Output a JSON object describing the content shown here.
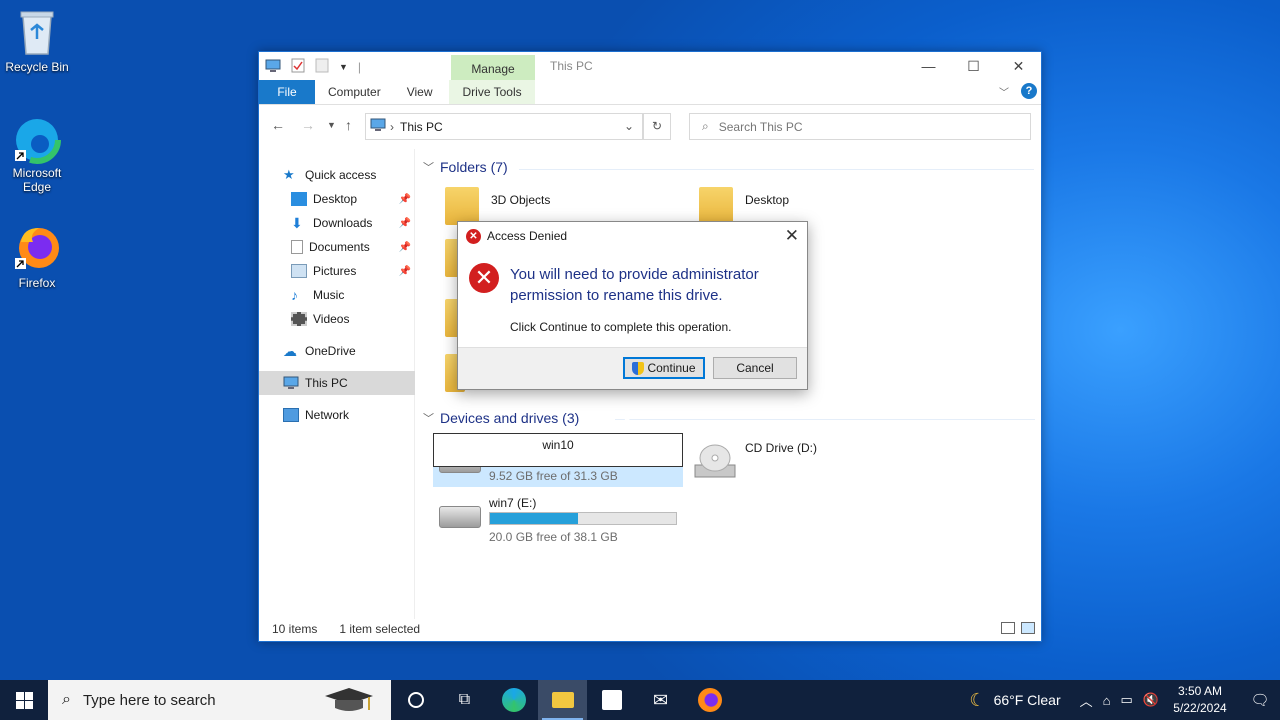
{
  "desktop": {
    "icons": [
      {
        "label": "Recycle Bin"
      },
      {
        "label": "Microsoft Edge"
      },
      {
        "label": "Firefox"
      }
    ]
  },
  "explorer": {
    "title": "This PC",
    "contextual_tab": "Manage",
    "ribbon_tabs": [
      "File",
      "Computer",
      "View",
      "Drive Tools"
    ],
    "address": "This PC",
    "search_placeholder": "Search This PC",
    "sidebar": {
      "quick_access": "Quick access",
      "items": [
        "Desktop",
        "Downloads",
        "Documents",
        "Pictures",
        "Music",
        "Videos"
      ],
      "onedrive": "OneDrive",
      "this_pc": "This PC",
      "network": "Network"
    },
    "folders": {
      "header": "Folders (7)",
      "items": [
        "3D Objects",
        "Desktop"
      ]
    },
    "drives": {
      "header": "Devices and drives (3)",
      "items": [
        {
          "name": "win10",
          "free": "9.52 GB free of 31.3 GB",
          "used_fraction": 0.7
        },
        {
          "name": "CD Drive (D:)"
        },
        {
          "name": "win7 (E:)",
          "free": "20.0 GB free of 38.1 GB",
          "used_fraction": 0.475
        }
      ]
    },
    "status": {
      "count": "10 items",
      "selection": "1 item selected"
    }
  },
  "dialog": {
    "title": "Access Denied",
    "message": "You will need to provide administrator permission to rename this drive.",
    "sub": "Click Continue to complete this operation.",
    "continue": "Continue",
    "cancel": "Cancel"
  },
  "taskbar": {
    "search_placeholder": "Type here to search",
    "weather": "66°F  Clear",
    "time": "3:50 AM",
    "date": "5/22/2024"
  },
  "colors": {
    "accent": "#1979ca",
    "error": "#d21f1f",
    "taskbar": "#10213d"
  }
}
